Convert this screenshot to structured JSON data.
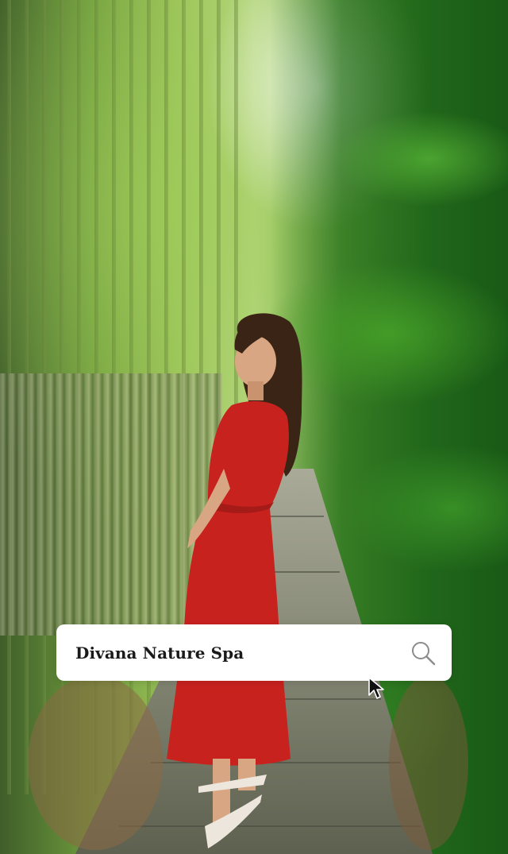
{
  "search": {
    "value": "Divana Nature Spa"
  },
  "icons": {
    "search": "search-icon",
    "cursor": "mouse-pointer-icon"
  },
  "colors": {
    "dress": "#c8221f",
    "foliage_dark": "#1f5a18",
    "foliage_light": "#b9d886",
    "card": "#ffffff",
    "text": "#1a1a1a",
    "icon": "#8c8c8c"
  }
}
